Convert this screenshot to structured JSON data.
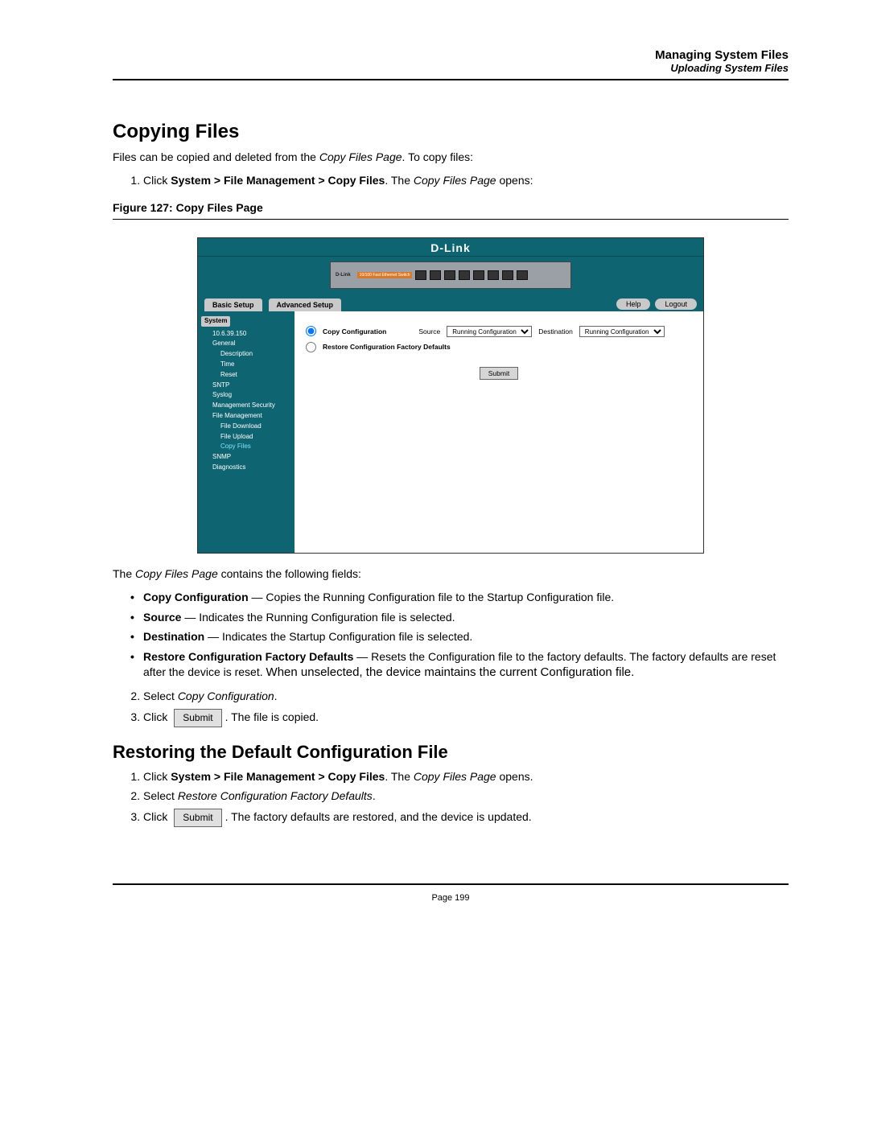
{
  "header": {
    "title": "Managing System Files",
    "subtitle": "Uploading System Files"
  },
  "section1": {
    "heading": "Copying Files",
    "intro_a": "Files can be copied and deleted from the ",
    "intro_b_i": "Copy Files Page",
    "intro_c": ". To copy files:",
    "step1_a": "Click ",
    "step1_b": "System > File Management > Copy Files",
    "step1_c": ". The ",
    "step1_d_i": "Copy Files Page",
    "step1_e": "  opens:",
    "figure_label": "Figure 127: Copy Files Page"
  },
  "screenshot": {
    "brand": "D-Link",
    "device_label": "D-Link",
    "device_orange": "10/100 Fast Ethernet Switch",
    "tabs": {
      "basic": "Basic Setup",
      "advanced": "Advanced Setup"
    },
    "pills": {
      "help": "Help",
      "logout": "Logout"
    },
    "sidebar": {
      "head": "System",
      "ip": "10.6.39.150",
      "items": [
        {
          "label": "General",
          "level": 1
        },
        {
          "label": "Description",
          "level": 2
        },
        {
          "label": "Time",
          "level": 2
        },
        {
          "label": "Reset",
          "level": 2
        },
        {
          "label": "SNTP",
          "level": 1
        },
        {
          "label": "Syslog",
          "level": 1
        },
        {
          "label": "Management Security",
          "level": 1
        },
        {
          "label": "File Management",
          "level": 1
        },
        {
          "label": "File Download",
          "level": 2
        },
        {
          "label": "File Upload",
          "level": 2
        },
        {
          "label": "Copy Files",
          "level": 2,
          "hilite": true
        },
        {
          "label": "SNMP",
          "level": 1
        },
        {
          "label": "Diagnostics",
          "level": 1
        }
      ]
    },
    "form": {
      "opt_copy": "Copy Configuration",
      "opt_restore": "Restore Configuration Factory Defaults",
      "source_label": "Source",
      "source_value": "Running Configuration",
      "dest_label": "Destination",
      "dest_value": "Running Configuration",
      "submit": "Submit"
    }
  },
  "below": {
    "intro_a": "The ",
    "intro_b_i": "Copy Files Page",
    "intro_c": " contains the following fields:",
    "b1_a": "Copy Configuration",
    "b1_b": " — Copies the Running Configuration file to the Startup Configuration file.",
    "b2_a": "Source",
    "b2_b": " — Indicates the Running Configuration file is selected.",
    "b3_a": "Destination",
    "b3_b": " — Indicates the Startup Configuration file is selected.",
    "b4_a": "Restore Configuration Factory Defaults",
    "b4_b": " — Resets the Configuration file to the factory defaults. The factory defaults are reset after the device is reset. ",
    "b4_c": "When unselected, the device maintains the current Configuration file.",
    "step2_a": "Select ",
    "step2_b_i": "Copy Configuration",
    "step2_c": ".",
    "step3_a": "Click ",
    "step3_btn": "Submit",
    "step3_b": ". The file is copied."
  },
  "section2": {
    "heading": "Restoring the Default Configuration File",
    "step1_a": "Click ",
    "step1_b": "System > File Management > Copy Files",
    "step1_c": ". The ",
    "step1_d_i": "Copy Files Page",
    "step1_e": "  opens.",
    "step2_a": "Select ",
    "step2_b_i": "Restore Configuration Factory Defaults",
    "step2_c": ".",
    "step3_a": "Click ",
    "step3_btn": "Submit",
    "step3_b": ". The factory defaults are restored, and the device is updated."
  },
  "page_number": "Page 199"
}
